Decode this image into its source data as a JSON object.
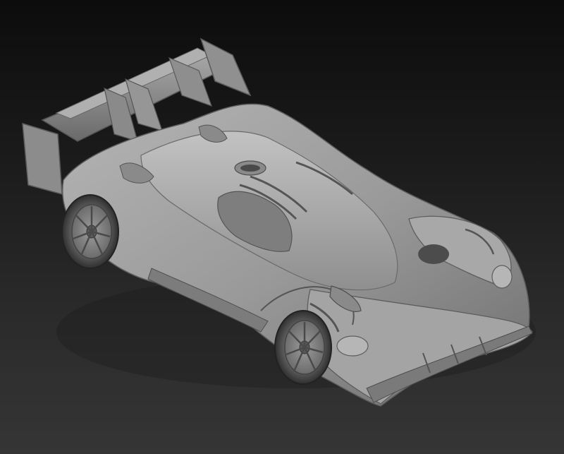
{
  "scene": {
    "subject": "sculpted-hypercar-model",
    "material": "matte-gray-clay",
    "background_colors": [
      "#0c0c0c",
      "#2b2b2b",
      "#353535"
    ],
    "body_color": "#9a9a9a"
  }
}
